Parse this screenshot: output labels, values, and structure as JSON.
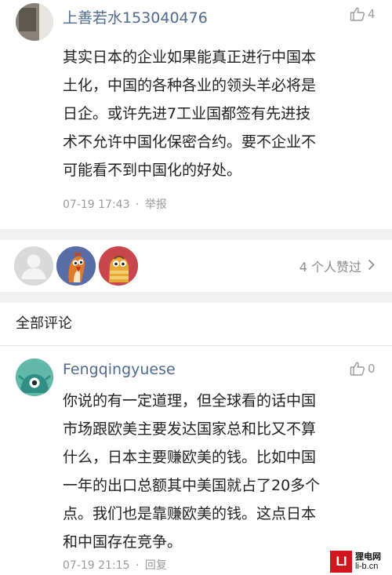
{
  "top_comment": {
    "username": "上善若水153040476",
    "likes": "4",
    "lines": [
      "其实日本的企业如果能真正进行中国本",
      "土化，中国的各种各业的领头羊必将是",
      "日企。或许先进7工业国都签有先进技",
      "术不允许中国化保密合约。要不企业不",
      "可能看不到中国化的好处。"
    ],
    "timestamp": "07-19 17:43",
    "separator": "·",
    "action": "举报"
  },
  "likers": {
    "count_label": "4 个人赞过"
  },
  "all_comments": {
    "title": "全部评论"
  },
  "reply_comment": {
    "username": "Fengqingyuese",
    "likes": "0",
    "lines": [
      "你说的有一定道理，但全球看的话中国",
      "市场跟欧美主要发达国家总和比又不算",
      "什么，日本主要赚欧美的钱。比如中国",
      "一年的出口总额其中美国就占了20多个",
      "点。我们也是靠赚欧美的钱。这点日本",
      "和中国存在竞争。"
    ],
    "timestamp": "07-19 21:15",
    "separator": "·",
    "action": "回复"
  },
  "watermark": {
    "logo": "LI",
    "name": "狸电网",
    "url": "li-b.cn"
  },
  "colors": {
    "username": "#4f6a8f",
    "meta": "#9a9a9a",
    "band": "#f1f1f1",
    "brand_red": "#d2161e"
  }
}
